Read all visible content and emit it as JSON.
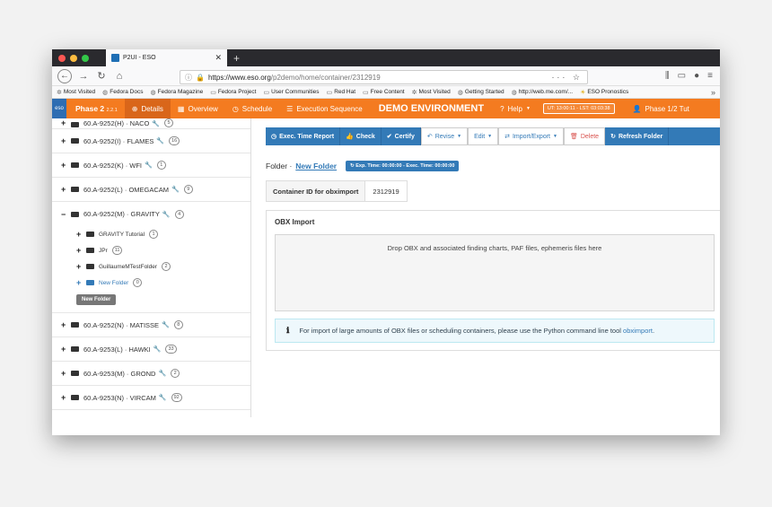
{
  "browser": {
    "tab_title": "P2UI - ESO",
    "url_host": "https://www.eso.org",
    "url_path": "/p2demo/home/container/2312919",
    "traffic": [
      "#fc5753",
      "#fdbc40",
      "#33c748"
    ],
    "bookmarks": [
      "Most Visited",
      "Fedora Docs",
      "Fedora Magazine",
      "Fedora Project",
      "User Communities",
      "Red Hat",
      "Free Content",
      "Most Visited",
      "Getting Started",
      "http://web.me.com/...",
      "ESO Pronostics"
    ]
  },
  "appnav": {
    "brand": "Phase 2",
    "version": "2.2.1",
    "details": "Details",
    "overview": "Overview",
    "schedule": "Schedule",
    "execution_sequence": "Execution Sequence",
    "demo": "DEMO ENVIRONMENT",
    "help": "Help",
    "time": "UT: 13:00:11 - LST: 03:03:38",
    "tutorial": "Phase 1/2 Tut"
  },
  "sidebar": {
    "top": "60.A-9252(H) · NACO",
    "top_badge": "5",
    "items_before": [
      {
        "label": "60.A-9252(I) · FLAMES",
        "badge": "16"
      },
      {
        "label": "60.A-9252(K) · WFI",
        "badge": "1"
      },
      {
        "label": "60.A-9252(L) · OMEGACAM",
        "badge": "9"
      }
    ],
    "expanded": {
      "label": "60.A-9252(M) · GRAVITY",
      "badge": "4",
      "children": [
        {
          "label": "GRAVITY Tutorial",
          "badge": "1"
        },
        {
          "label": "JPr",
          "badge": "11"
        },
        {
          "label": "GuillaumeMTestFolder",
          "badge": "2"
        },
        {
          "label": "New Folder",
          "badge": "0"
        }
      ],
      "new_folder_button": "New Folder"
    },
    "items_after": [
      {
        "label": "60.A-9252(N) · MATISSE",
        "badge": "8"
      },
      {
        "label": "60.A-9253(L) · HAWKI",
        "badge": "33"
      },
      {
        "label": "60.A-9253(M) · GROND",
        "badge": "2"
      },
      {
        "label": "60.A-9253(N) · VIRCAM",
        "badge": "92"
      }
    ]
  },
  "toolbar": {
    "exec_time_report": "Exec. Time Report",
    "check": "Check",
    "certify": "Certify",
    "revise": "Revise",
    "edit": "Edit",
    "import_export": "Import/Export",
    "delete": "Delete",
    "refresh_folder": "Refresh Folder"
  },
  "main": {
    "folder_label": "Folder ·",
    "folder_name": "New Folder",
    "exp_time": "Exp. Time: 00:00:00 - Exec. Time: 00:00:00",
    "container_id_label": "Container ID for obximport",
    "container_id_value": "2312919",
    "obx_title": "OBX Import",
    "drop_text": "Drop OBX and associated finding charts, PAF files, ephemeris files here",
    "info_text": "For import of large amounts of OBX files or scheduling containers, please use the Python command line tool",
    "info_link": "obximport",
    "info_end": "."
  }
}
